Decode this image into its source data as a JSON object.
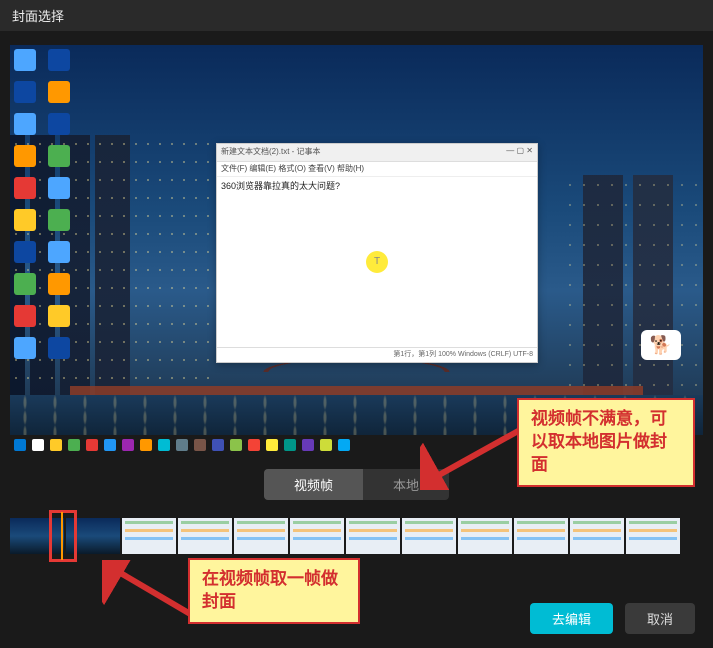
{
  "header": {
    "title": "封面选择"
  },
  "preview": {
    "notepad": {
      "title_left": "新建文本文档(2).txt - 记事本",
      "menu": "文件(F) 编辑(E) 格式(O) 查看(V) 帮助(H)",
      "content": "360浏览器靠拉真的太大问题?",
      "marker": "T",
      "status": "第1行，第1列   100%   Windows (CRLF)   UTF-8"
    },
    "sticker": "🐕"
  },
  "tabs": {
    "video_frame": "视频帧",
    "local": "本地"
  },
  "buttons": {
    "edit": "去编辑",
    "cancel": "取消"
  },
  "annotations": {
    "right": "视频帧不满意，可以取本地图片做封面",
    "bottom": "在视频帧取一帧做封面"
  }
}
